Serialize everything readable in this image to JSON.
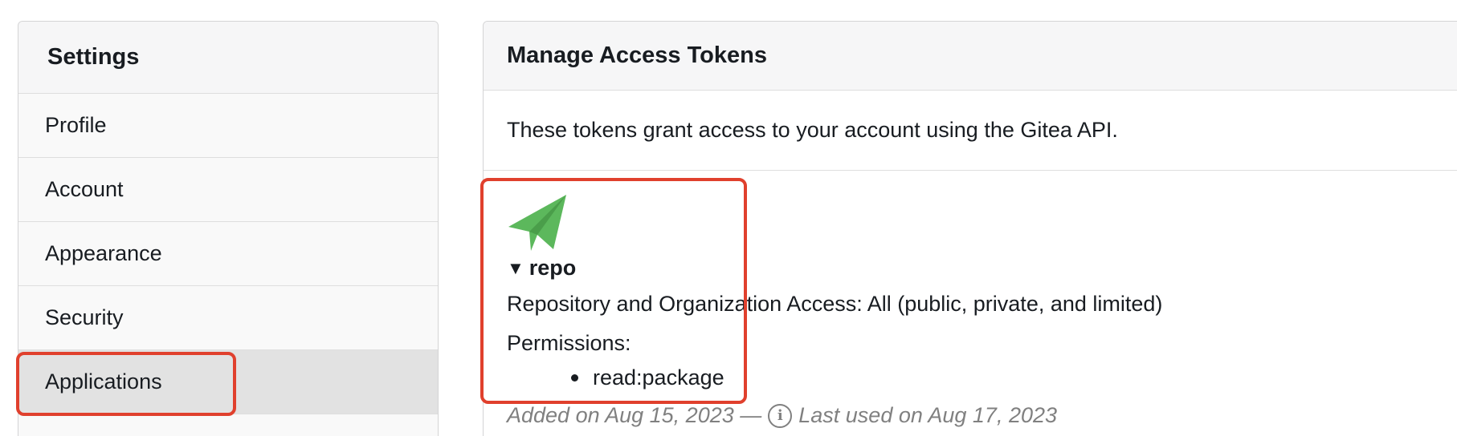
{
  "sidebar": {
    "title": "Settings",
    "items": [
      {
        "label": "Profile"
      },
      {
        "label": "Account"
      },
      {
        "label": "Appearance"
      },
      {
        "label": "Security"
      },
      {
        "label": "Applications",
        "active": true
      }
    ]
  },
  "main": {
    "title": "Manage Access Tokens",
    "description": "These tokens grant access to your account using the Gitea API.",
    "token": {
      "icon": "paper-plane-icon",
      "icon_color": "#5cb85c",
      "name": "repo",
      "access": "Repository and Organization Access: All (public, private, and limited)",
      "permissions_label": "Permissions:",
      "permissions": [
        "read:package"
      ],
      "added": "Added on Aug 15, 2023 —",
      "last_used": "Last used on Aug 17, 2023"
    }
  },
  "highlight_color": "#e0402d"
}
